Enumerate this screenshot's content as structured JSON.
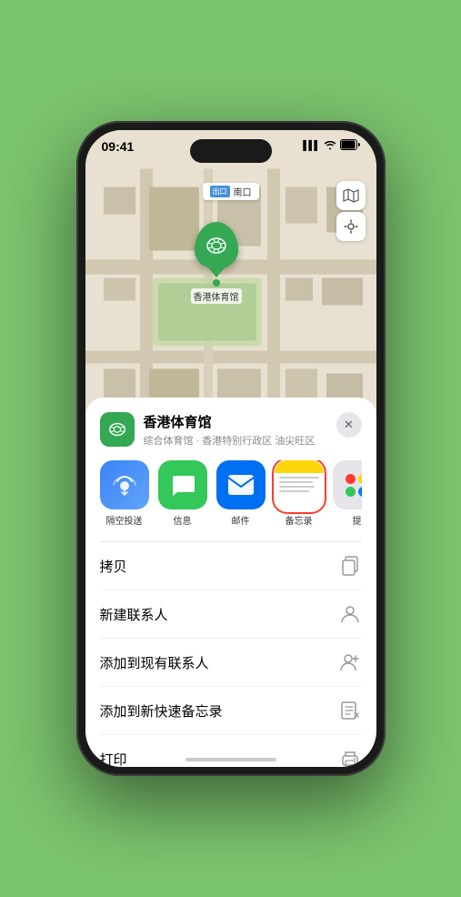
{
  "phone": {
    "status_bar": {
      "time": "09:41",
      "navigation_icon": "▶",
      "signal_bars": "▌▌▌",
      "wifi_icon": "wifi",
      "battery_icon": "battery"
    }
  },
  "map": {
    "label": "南口",
    "label_prefix": "出口",
    "location_name": "香港体育馆",
    "map_type_icon": "map",
    "compass_icon": "compass"
  },
  "location_card": {
    "name": "香港体育馆",
    "subtitle": "综合体育馆 · 香港特别行政区 油尖旺区",
    "close_label": "×"
  },
  "share_apps": [
    {
      "id": "airdrop",
      "label": "隔空投送",
      "type": "airdrop"
    },
    {
      "id": "messages",
      "label": "信息",
      "type": "messages"
    },
    {
      "id": "mail",
      "label": "邮件",
      "type": "mail"
    },
    {
      "id": "notes",
      "label": "备忘录",
      "type": "notes"
    },
    {
      "id": "more",
      "label": "提",
      "type": "more"
    }
  ],
  "actions": [
    {
      "id": "copy",
      "label": "拷贝",
      "icon": "copy"
    },
    {
      "id": "new-contact",
      "label": "新建联系人",
      "icon": "person"
    },
    {
      "id": "add-existing-contact",
      "label": "添加到现有联系人",
      "icon": "person-add"
    },
    {
      "id": "add-quick-note",
      "label": "添加到新快速备忘录",
      "icon": "quick-note"
    },
    {
      "id": "print",
      "label": "打印",
      "icon": "print"
    }
  ],
  "icons": {
    "copy": "⎘",
    "person": "👤",
    "person-add": "👤",
    "quick-note": "📋",
    "print": "🖨",
    "map": "🗺",
    "compass": "➤",
    "wifi": "📶",
    "battery": "🔋"
  }
}
